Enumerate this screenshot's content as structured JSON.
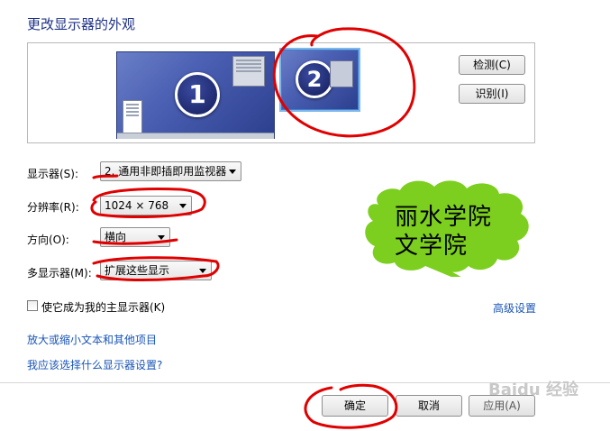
{
  "title": "更改显示器的外观",
  "preview": {
    "monitor1_number": "1",
    "monitor2_number": "2",
    "detect_label": "检测(C)",
    "identify_label": "识别(I)"
  },
  "settings": {
    "display_label": "显示器(S):",
    "display_value": "2. 通用非即插即用监视器",
    "resolution_label": "分辨率(R):",
    "resolution_value": "1024 × 768",
    "orientation_label": "方向(O):",
    "orientation_value": "横向",
    "multi_label": "多显示器(M):",
    "multi_value": "扩展这些显示"
  },
  "primary_checkbox_label": "使它成为我的主显示器(K)",
  "advanced_link": "高级设置",
  "links": {
    "text_size": "放大或缩小文本和其他项目",
    "which_settings": "我应该选择什么显示器设置?"
  },
  "buttons": {
    "ok": "确定",
    "cancel": "取消",
    "apply": "应用(A)"
  },
  "annotation": {
    "bubble_line1": "丽水学院",
    "bubble_line2": "文学院",
    "bubble_color": "#7ccf1e",
    "scribble_color": "#e00000"
  },
  "watermark": "Baidu 经验"
}
